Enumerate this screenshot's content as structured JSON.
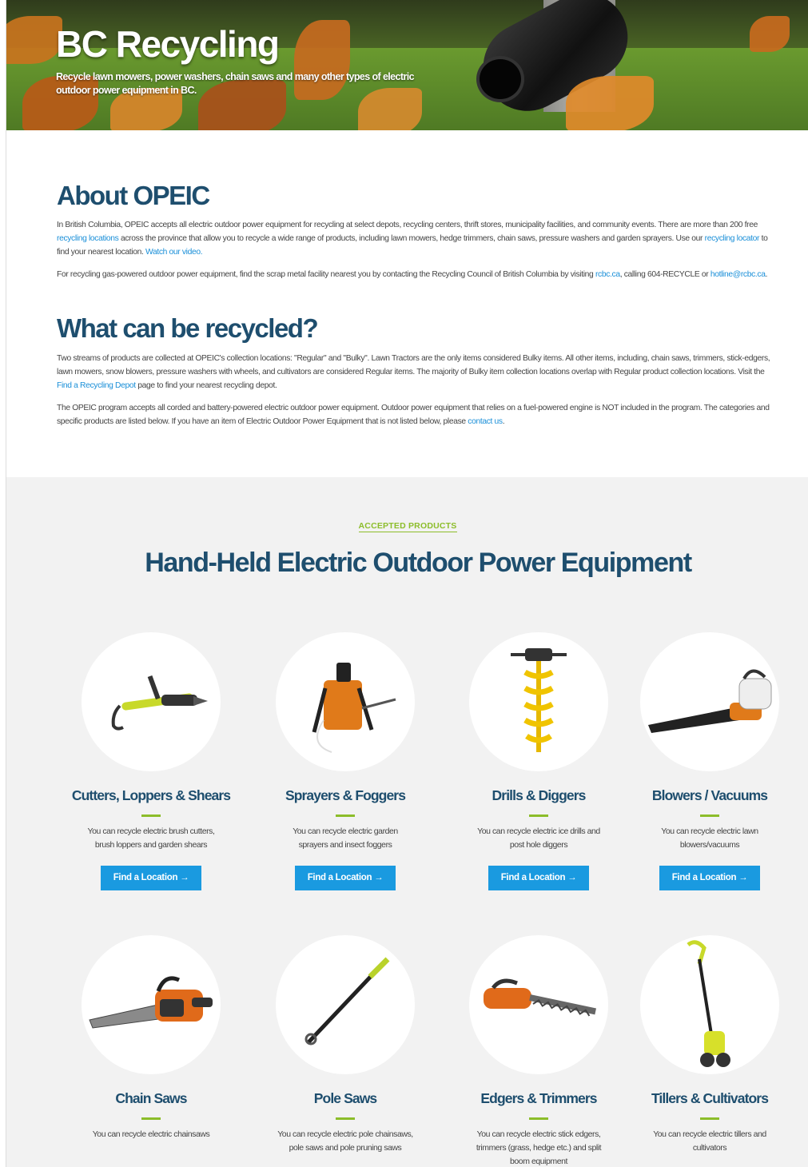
{
  "hero": {
    "title": "BC Recycling",
    "subtitle": "Recycle lawn mowers, power washers, chain saws and many other types of electric outdoor power equipment in BC."
  },
  "about": {
    "title": "About OPEIC",
    "p1_a": "In British Columbia, OPEIC accepts all electric outdoor power equipment for recycling at select depots, recycling centers, thrift stores, municipality facilities, and community events. There are more than 200 free ",
    "p1_link1": "recycling locations",
    "p1_b": " across the province that allow you to recycle a wide range of products, including lawn mowers, hedge trimmers, chain saws, pressure washers and garden sprayers. Use our ",
    "p1_link2": "recycling locator",
    "p1_c": " to find your nearest location. ",
    "p1_link3": "Watch our video.",
    "p2_a": "For recycling gas-powered outdoor power equipment, find the scrap metal facility nearest you by contacting the Recycling Council of British Columbia by visiting ",
    "p2_link1": "rcbc.ca",
    "p2_b": ", calling 604-RECYCLE or ",
    "p2_link2": "hotline@rcbc.ca",
    "p2_c": "."
  },
  "what": {
    "title": "What can be recycled?",
    "p1_a": "Two streams of products are collected at OPEIC's collection locations: \"Regular\" and \"Bulky\". Lawn Tractors are the only items considered Bulky items. All other items, including, chain saws, trimmers, stick-edgers, lawn mowers, snow blowers, pressure washers with wheels, and cultivators are considered Regular items. The majority of Bulky item collection locations overlap with Regular product collection locations. Visit the ",
    "p1_link": "Find a Recycling Depot",
    "p1_b": " page to find your nearest recycling depot.",
    "p2_a": "The OPEIC program accepts all corded and battery-powered electric outdoor power equipment. Outdoor power equipment that relies on a fuel-powered engine is NOT included in the program. The categories and specific products are listed below. If you have an item of Electric Outdoor Power Equipment that is not listed below, please ",
    "p2_link": "contact us",
    "p2_b": "."
  },
  "products": {
    "eyebrow": "ACCEPTED PRODUCTS",
    "title": "Hand-Held Electric Outdoor Power Equipment",
    "button_label": "Find a Location  →",
    "items": [
      {
        "title": "Cutters, Loppers & Shears",
        "desc": "You can recycle electric brush cutters, brush loppers and garden shears",
        "icon": "cutter-icon"
      },
      {
        "title": "Sprayers & Foggers",
        "desc": "You can recycle electric garden sprayers and insect foggers",
        "icon": "sprayer-icon"
      },
      {
        "title": "Drills & Diggers",
        "desc": "You can recycle electric ice drills and post hole diggers",
        "icon": "auger-drill-icon"
      },
      {
        "title": "Blowers / Vacuums",
        "desc": "You can recycle electric lawn blowers/vacuums",
        "icon": "leaf-blower-icon"
      },
      {
        "title": "Chain Saws",
        "desc": "You can recycle electric chainsaws",
        "icon": "chainsaw-icon"
      },
      {
        "title": "Pole Saws",
        "desc": "You can recycle electric pole chainsaws, pole saws and pole pruning saws",
        "icon": "pole-saw-icon"
      },
      {
        "title": "Edgers & Trimmers",
        "desc": "You can recycle electric stick edgers, trimmers (grass, hedge etc.) and split boom equipment",
        "icon": "hedge-trimmer-icon"
      },
      {
        "title": "Tillers & Cultivators",
        "desc": "You can recycle electric tillers and cultivators",
        "icon": "tiller-icon"
      }
    ]
  },
  "colors": {
    "heading": "#1e4e6e",
    "accent_green": "#8cbd2a",
    "button_blue": "#1a9ae0",
    "link": "#1a8fd8"
  }
}
